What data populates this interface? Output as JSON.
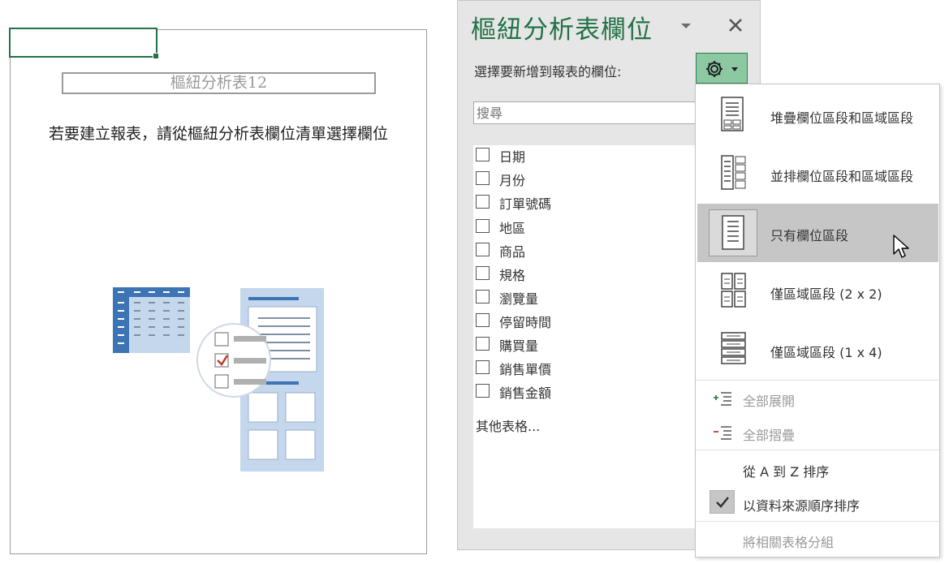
{
  "pivot": {
    "name": "樞紐分析表12",
    "instruction": "若要建立報表，請從樞紐分析表欄位清單選擇欄位"
  },
  "pane": {
    "title": "樞紐分析表欄位",
    "subtitle": "選擇要新增到報表的欄位:",
    "search_placeholder": "搜尋",
    "fields": [
      "日期",
      "月份",
      "訂單號碼",
      "地區",
      "商品",
      "規格",
      "瀏覽量",
      "停留時間",
      "購買量",
      "銷售單價",
      "銷售金額"
    ],
    "more_tables": "其他表格..."
  },
  "menu": {
    "layouts": [
      {
        "label": "堆疊欄位區段和區域區段",
        "icon": "stacked-layout-icon"
      },
      {
        "label": "並排欄位區段和區域區段",
        "icon": "side-by-side-layout-icon"
      },
      {
        "label": "只有欄位區段",
        "icon": "fields-only-layout-icon",
        "selected": true
      },
      {
        "label": "僅區域區段 (2 x 2)",
        "icon": "areas-2x2-layout-icon"
      },
      {
        "label": "僅區域區段 (1 x 4)",
        "icon": "areas-1x4-layout-icon"
      }
    ],
    "expand_all": "全部展開",
    "collapse_all": "全部摺疊",
    "sort_az": "從 A 到 Z 排序",
    "sort_source": "以資料來源順序排序",
    "group_tables": "將相關表格分組"
  },
  "colors": {
    "accent": "#217346",
    "gear_button": "#8cc9a3",
    "illustration_blue": "#3d74b3",
    "illustration_light": "#c4d7ec",
    "check_red": "#c0392b"
  }
}
